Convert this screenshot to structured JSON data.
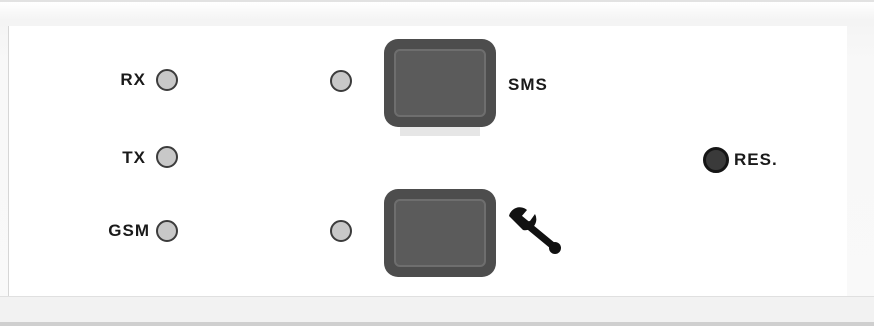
{
  "indicators": {
    "rx_label": "RX",
    "tx_label": "TX",
    "gsm_label": "GSM"
  },
  "keys": {
    "sms_label": "SMS",
    "service_icon": "wrench-icon"
  },
  "reset": {
    "label": "RES."
  },
  "colors": {
    "led_off": "#c8c8c8",
    "key_body": "#4d4d4d",
    "reset_led": "#3a3a3a"
  }
}
